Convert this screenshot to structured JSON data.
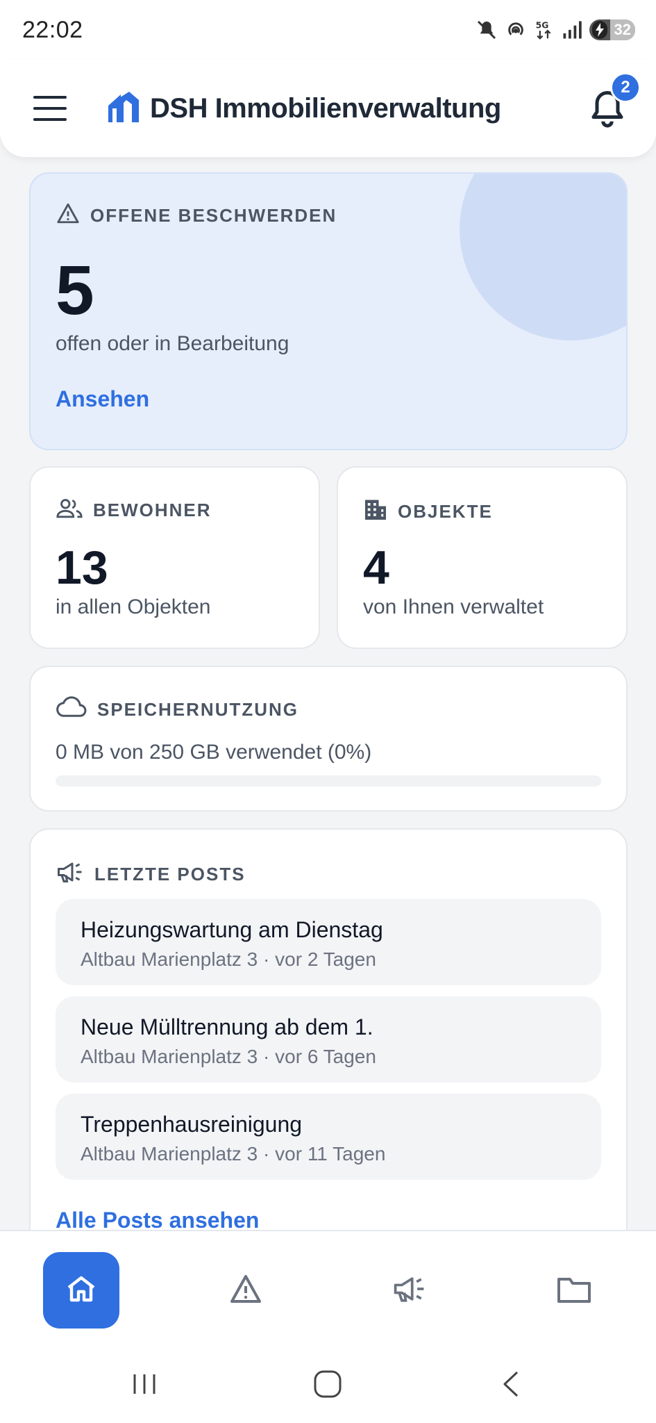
{
  "status_bar": {
    "time": "22:02",
    "icons": [
      "mute-icon",
      "hotspot-icon",
      "network-5g-icon",
      "signal-icon"
    ],
    "battery": "32"
  },
  "header": {
    "app_title": "DSH Immobilienverwaltung",
    "notification_count": "2",
    "accent": "#2f6fe0"
  },
  "complaints": {
    "label": "OFFENE BESCHWERDEN",
    "count": "5",
    "subtitle": "offen oder in Bearbeitung",
    "link": "Ansehen"
  },
  "residents": {
    "label": "BEWOHNER",
    "count": "13",
    "subtitle": "in allen Objekten"
  },
  "objects": {
    "label": "OBJEKTE",
    "count": "4",
    "subtitle": "von Ihnen verwaltet"
  },
  "storage": {
    "label": "SPEICHERNUTZUNG",
    "text": "0 MB von 250 GB verwendet (0%)",
    "used_fraction": 0
  },
  "posts": {
    "label": "LETZTE POSTS",
    "items": [
      {
        "title": "Heizungswartung am Dienstag",
        "meta": "Altbau Marienplatz 3 · vor 2 Tagen"
      },
      {
        "title": "Neue Mülltrennung ab dem 1.",
        "meta": "Altbau Marienplatz 3 · vor 6 Tagen"
      },
      {
        "title": "Treppenhausreinigung",
        "meta": "Altbau Marienplatz 3 · vor 11 Tagen"
      }
    ],
    "all_link": "Alle Posts ansehen"
  },
  "bottom_nav": {
    "items": [
      "home-icon",
      "warning-icon",
      "megaphone-icon",
      "folder-icon"
    ],
    "active_index": 0
  }
}
